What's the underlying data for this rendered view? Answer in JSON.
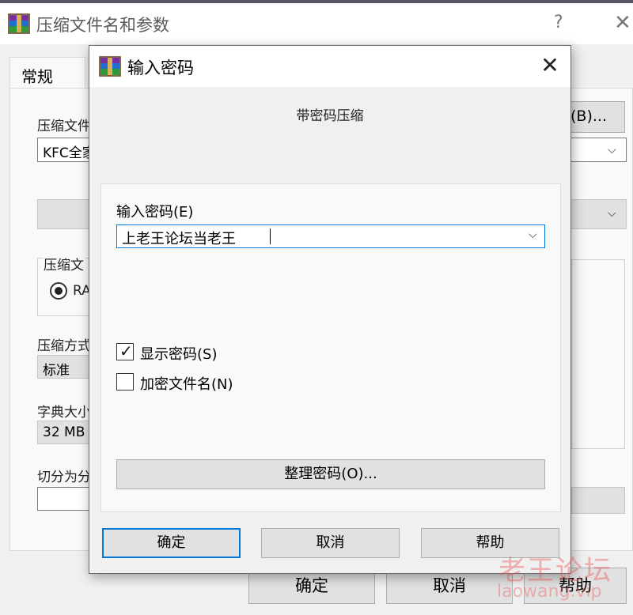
{
  "back_window": {
    "title": "压缩文件名和参数",
    "help_label": "?",
    "close_label": "✕",
    "tab_general": "常规",
    "archive_name_label": "压缩文件名",
    "archive_name_value": "KFC全家",
    "browse_label": "(B)...",
    "format_group_label": "压缩文",
    "format_option": "RA",
    "method_label": "压缩方式",
    "method_value": "标准",
    "dict_label": "字典大小",
    "dict_value": "32 MB",
    "split_label": "切分为分",
    "ok_label": "确定",
    "cancel_label": "取消",
    "help_btn_label": "帮助"
  },
  "dialog": {
    "title": "输入密码",
    "close_label": "✕",
    "header": "带密码压缩",
    "password_label": "输入密码(E)",
    "password_value": "上老王论坛当老王",
    "show_password_label": "显示密码(S)",
    "show_password_checked": true,
    "encrypt_names_label": "加密文件名(N)",
    "encrypt_names_checked": false,
    "organize_label": "整理密码(O)...",
    "ok_label": "确定",
    "cancel_label": "取消",
    "help_label": "帮助",
    "check_glyph": "✓",
    "dropdown_glyph": "⌵"
  },
  "watermark": {
    "cn": "老王论坛",
    "en": "laowang.vip"
  },
  "colors": {
    "accent": "#0078d7",
    "watermark": "#e85a5a"
  }
}
